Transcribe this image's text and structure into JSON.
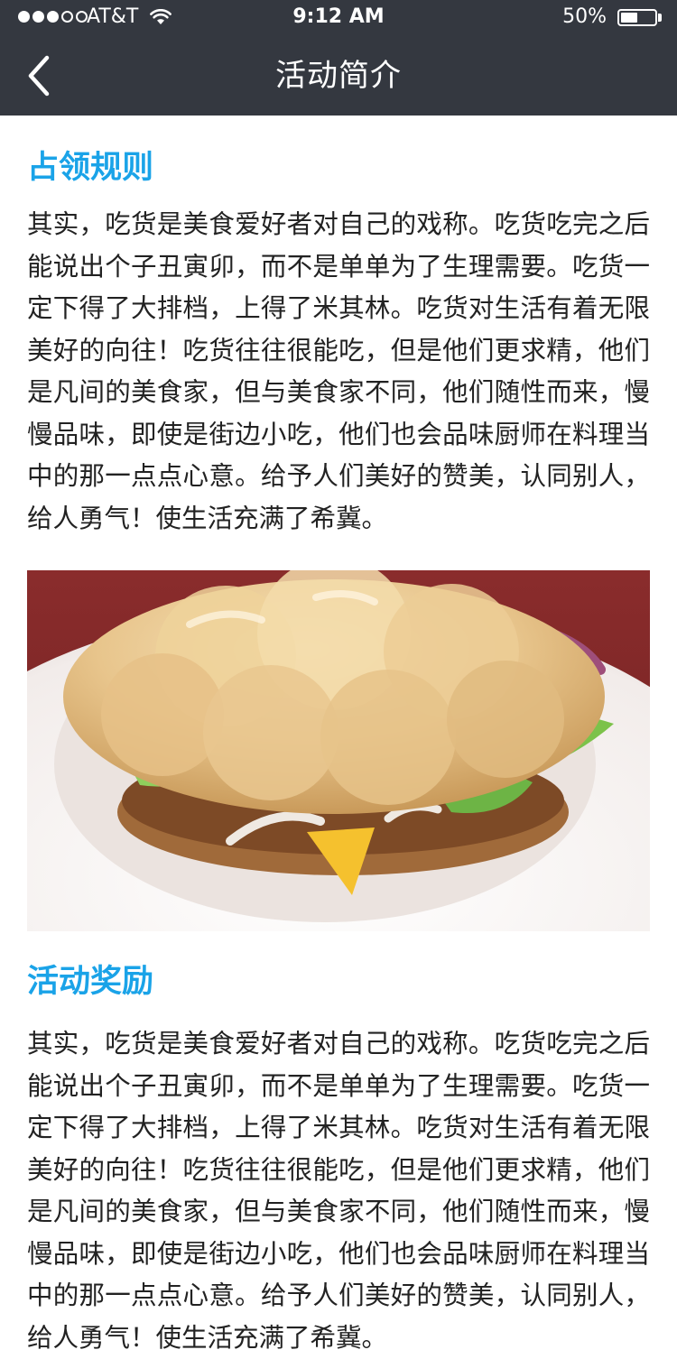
{
  "status_bar": {
    "carrier": "AT&T",
    "time": "9:12 AM",
    "battery_percent": "50%",
    "battery_level": 0.5,
    "signal_bars_filled": 3,
    "signal_bars_total": 5
  },
  "nav": {
    "title": "活动简介",
    "back_icon": "chevron-left-icon"
  },
  "sections": [
    {
      "heading": "占领规则",
      "text": "其实，吃货是美食爱好者对自己的戏称。吃货吃完之后能说出个子丑寅卯，而不是单单为了生理需要。吃货一定下得了大排档，上得了米其林。吃货对生活有着无限美好的向往！吃货往往很能吃，但是他们更求精，他们是凡间的美食家，但与美食家不同，他们随性而来，慢慢品味，即使是街边小吃，他们也会品味厨师在料理当中的那一点点心意。给予人们美好的赞美，认同别人，给人勇气！使生活充满了希冀。"
    },
    {
      "heading": "活动奖励",
      "text": "其实，吃货是美食爱好者对自己的戏称。吃货吃完之后能说出个子丑寅卯，而不是单单为了生理需要。吃货一定下得了大排档，上得了米其林。吃货对生活有着无限美好的向往！吃货往往很能吃，但是他们更求精，他们是凡间的美食家，但与美食家不同，他们随性而来，慢慢品味，即使是街边小吃，他们也会品味厨师在料理当中的那一点点心意。给予人们美好的赞美，认同别人，给人勇气！使生活充满了希冀。"
    }
  ],
  "colors": {
    "nav_background": "#343840",
    "heading_blue": "#1aa3e8",
    "body_text": "#222222"
  }
}
